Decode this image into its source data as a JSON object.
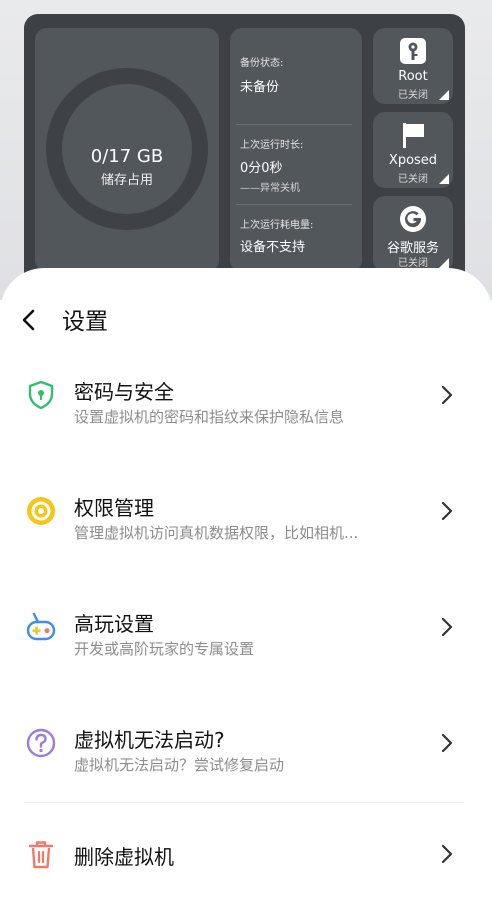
{
  "dashboard": {
    "storage": {
      "value": "0/17 GB",
      "label": "储存占用"
    },
    "status": {
      "backup_label": "备份状态:",
      "backup_value": "未备份",
      "runtime_label": "上次运行时长:",
      "runtime_value": "0分0秒",
      "runtime_note": "——异常关机",
      "power_label": "上次运行耗电量:",
      "power_value": "设备不支持"
    },
    "tiles": [
      {
        "name": "Root",
        "status": "已关闭",
        "icon": "key-icon"
      },
      {
        "name": "Xposed",
        "status": "已关闭",
        "icon": "flag-icon"
      },
      {
        "name": "谷歌服务",
        "status": "已关闭",
        "icon": "google-icon"
      }
    ]
  },
  "settings": {
    "title": "设置",
    "items": [
      {
        "title": "密码与安全",
        "desc": "设置虚拟机的密码和指纹来保护隐私信息",
        "icon": "shield-icon",
        "color": "#2fbf71"
      },
      {
        "title": "权限管理",
        "desc": "管理虚拟机访问真机数据权限，比如相机...",
        "icon": "target-icon",
        "color": "#f5c518"
      },
      {
        "title": "高玩设置",
        "desc": "开发或高阶玩家的专属设置",
        "icon": "gamepad-icon",
        "color": "#3d8ef0"
      },
      {
        "title": "虚拟机无法启动?",
        "desc": "虚拟机无法启动？尝试修复启动",
        "icon": "question-icon",
        "color": "#9b7be0"
      },
      {
        "title": "删除虚拟机",
        "icon": "trash-icon",
        "color": "#f07a6a"
      }
    ]
  }
}
